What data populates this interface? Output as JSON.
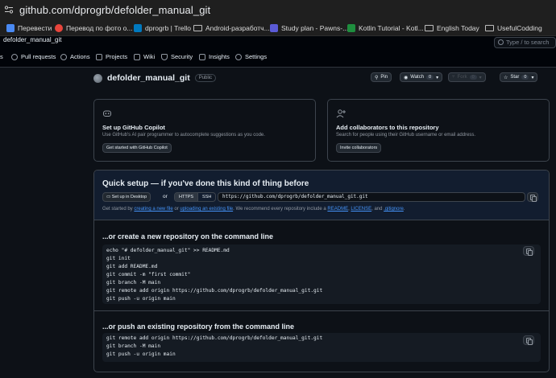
{
  "browser": {
    "url": "github.com/dprogrb/defolder_manual_git"
  },
  "bookmarks": [
    {
      "label": "Перевести",
      "icon": "translate-icon",
      "color": "#4a8af4"
    },
    {
      "label": "Перевод по фото о...",
      "icon": "photo-translate-icon",
      "color": "#e8453c"
    },
    {
      "label": "dprogrb | Trello",
      "icon": "trello-icon",
      "color": "#0079bf"
    },
    {
      "label": "Android-разработч...",
      "icon": "folder-icon",
      "color": "#bdbdbd"
    },
    {
      "label": "Study plan - Pawns-...",
      "icon": "notion-icon",
      "color": "#5b5bd6"
    },
    {
      "label": "Kotlin Tutorial - Kotl...",
      "icon": "kotlin-icon",
      "color": "#1e8e3e"
    },
    {
      "label": "English Today",
      "icon": "folder-icon",
      "color": "#bdbdbd"
    },
    {
      "label": "UsefulCodding",
      "icon": "folder-icon",
      "color": "#bdbdbd"
    }
  ],
  "github": {
    "breadcrumb": "defolder_manual_git",
    "search_hint": "Type / to search",
    "nav": [
      {
        "label": "s",
        "icon": "code-icon"
      },
      {
        "label": "Pull requests",
        "icon": "pull-request-icon"
      },
      {
        "label": "Actions",
        "icon": "actions-icon"
      },
      {
        "label": "Projects",
        "icon": "projects-icon"
      },
      {
        "label": "Wiki",
        "icon": "wiki-icon"
      },
      {
        "label": "Security",
        "icon": "shield-icon"
      },
      {
        "label": "Insights",
        "icon": "graph-icon"
      },
      {
        "label": "Settings",
        "icon": "gear-icon"
      }
    ],
    "repo": {
      "name": "defolder_manual_git",
      "visibility": "Public",
      "pin_label": "Pin",
      "watch_label": "Watch",
      "watch_count": "0",
      "fork_label": "Fork",
      "fork_count": "0",
      "star_label": "Star",
      "star_count": "0"
    },
    "copilot_card": {
      "title": "Set up GitHub Copilot",
      "text": "Use GitHub's AI pair programmer to autocomplete suggestions as you code.",
      "button": "Get started with GitHub Copilot"
    },
    "collab_card": {
      "title": "Add collaborators to this repository",
      "text": "Search for people using their GitHub username or email address.",
      "button": "Invite collaborators"
    },
    "quick_setup": {
      "title": "Quick setup — if you've done this kind of thing before",
      "desktop_button": "Set up in Desktop",
      "or": "or",
      "https": "HTTPS",
      "ssh": "SSH",
      "clone_url": "https://github.com/dprogrb/defolder_manual_git.git",
      "desc_1": "Get started by ",
      "desc_link_1": "creating a new file",
      "desc_2": " or ",
      "desc_link_2": "uploading an existing file",
      "desc_3": ". We recommend every repository include a ",
      "desc_link_3": "README",
      "desc_4": ", ",
      "desc_link_4": "LICENSE",
      "desc_5": ", and ",
      "desc_link_5": ".gitignore",
      "desc_6": "."
    },
    "create_section": {
      "title": "...or create a new repository on the command line",
      "lines": [
        "echo \"# defolder_manual_git\" >> README.md",
        "git init",
        "git add README.md",
        "git commit -m \"first commit\"",
        "git branch -M main",
        "git remote add origin https://github.com/dprogrb/defolder_manual_git.git",
        "git push -u origin main"
      ]
    },
    "push_section": {
      "title": "...or push an existing repository from the command line",
      "lines": [
        "git remote add origin https://github.com/dprogrb/defolder_manual_git.git",
        "git branch -M main",
        "git push -u origin main"
      ]
    }
  }
}
